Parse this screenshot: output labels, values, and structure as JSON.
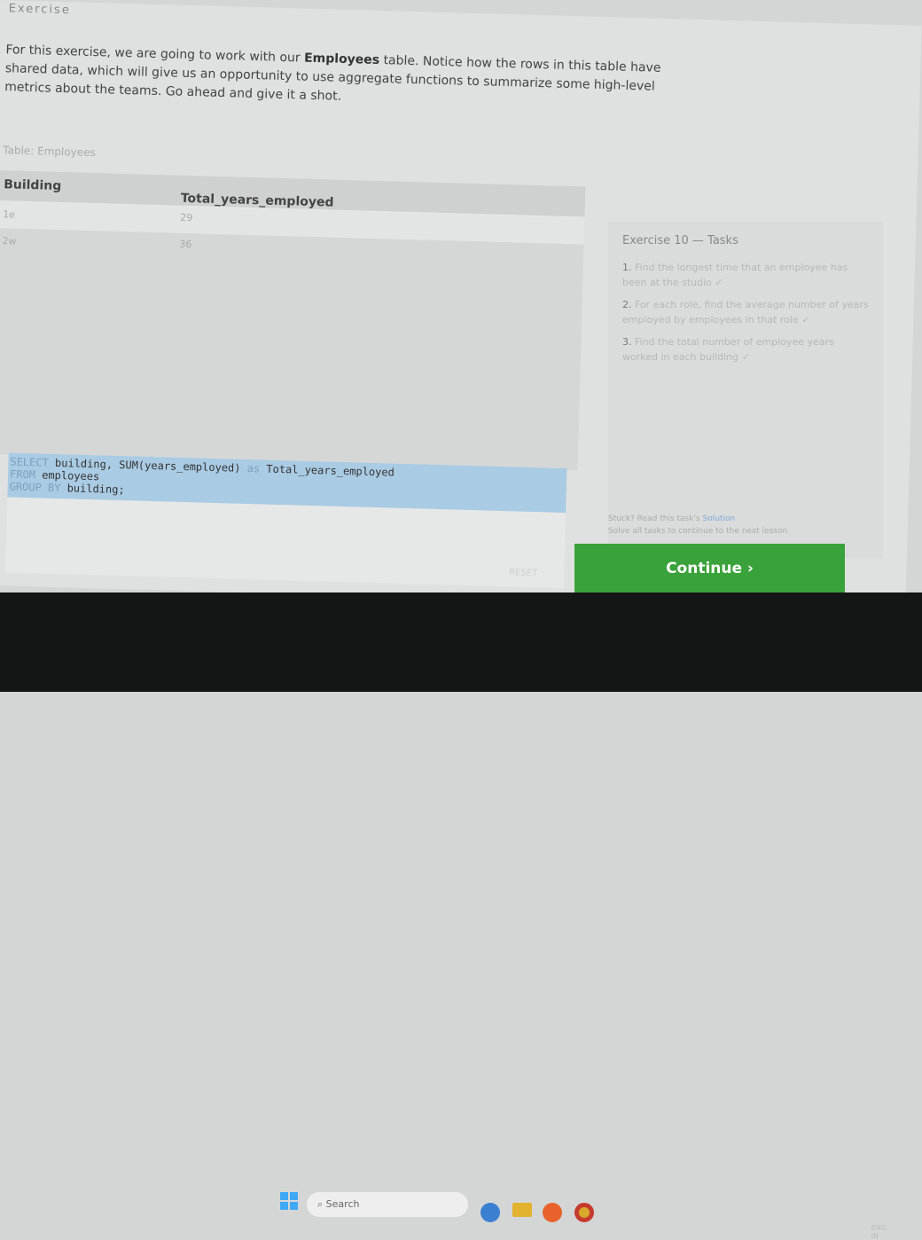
{
  "lesson": {
    "heading": "Exercise",
    "intro_before": "For this exercise, we are going to work with our ",
    "intro_bold": "Employees",
    "intro_after": " table. Notice how the rows in this table have shared data, which will give us an opportunity to use aggregate functions to summarize some high-level metrics about the teams. Go ahead and give it a shot."
  },
  "table": {
    "caption": "Table: Employees",
    "columns": [
      "Building",
      "Total_years_employed"
    ],
    "rows": [
      [
        "1e",
        "29"
      ],
      [
        "2w",
        "36"
      ]
    ]
  },
  "editor": {
    "line1_kw": "SELECT",
    "line1": " building, SUM(years_employed) ",
    "line1_as": "as",
    "line1_end": " Total_years_employed",
    "line2_kw": "FROM",
    "line2": " employees",
    "line3_kw": "GROUP BY",
    "line3": " building;",
    "reset_label": "RESET"
  },
  "tasks": {
    "title": "Exercise 10 — Tasks",
    "items": [
      {
        "num": "1.",
        "text": "Find the longest time that an employee has been at the studio ✓"
      },
      {
        "num": "2.",
        "text": "For each role, find the average number of years employed by employees in that role ✓"
      },
      {
        "num": "3.",
        "text": "Find the total number of employee years worked in each building ✓"
      }
    ],
    "stuck_text": "Stuck? Read this task's ",
    "solution_link": "Solution",
    "solve_all": "Solve all tasks to continue to the next lesson"
  },
  "continue_label": "Continue ›",
  "taskbar": {
    "search_placeholder": "Search",
    "lang": "ENG",
    "region": "IN"
  },
  "colors": {
    "continue": "#3aa23a",
    "code_highlight": "#a9cbe3"
  }
}
